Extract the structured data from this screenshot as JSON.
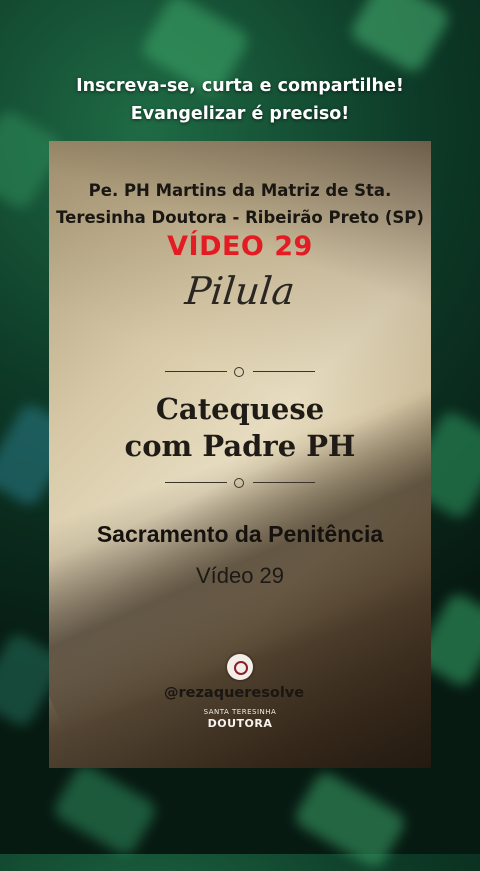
{
  "header": {
    "line1": "Inscreva-se, curta e compartilhe!",
    "line2": "Evangelizar é preciso!"
  },
  "card": {
    "priest_line1": "Pe. PH Martins da Matriz de Sta.",
    "priest_line2": "Teresinha Doutora - Ribeirão Preto (SP)",
    "video_title": "VÍDEO 29",
    "script_word": "Pilula",
    "catequese_line1": "Catequese",
    "catequese_line2": "com Padre PH",
    "subject": "Sacramento da Penitência",
    "video_sub": "Vídeo 29",
    "handle": "@rezaqueresolve",
    "logo_small": "SANTA TERESINHA",
    "logo_big": "DOUTORA"
  },
  "colors": {
    "accent_red": "#e31b23",
    "background_green": "#0d3a27"
  },
  "icons": {
    "divider": "ornament-divider-icon",
    "logo": "rose-logo-icon"
  }
}
